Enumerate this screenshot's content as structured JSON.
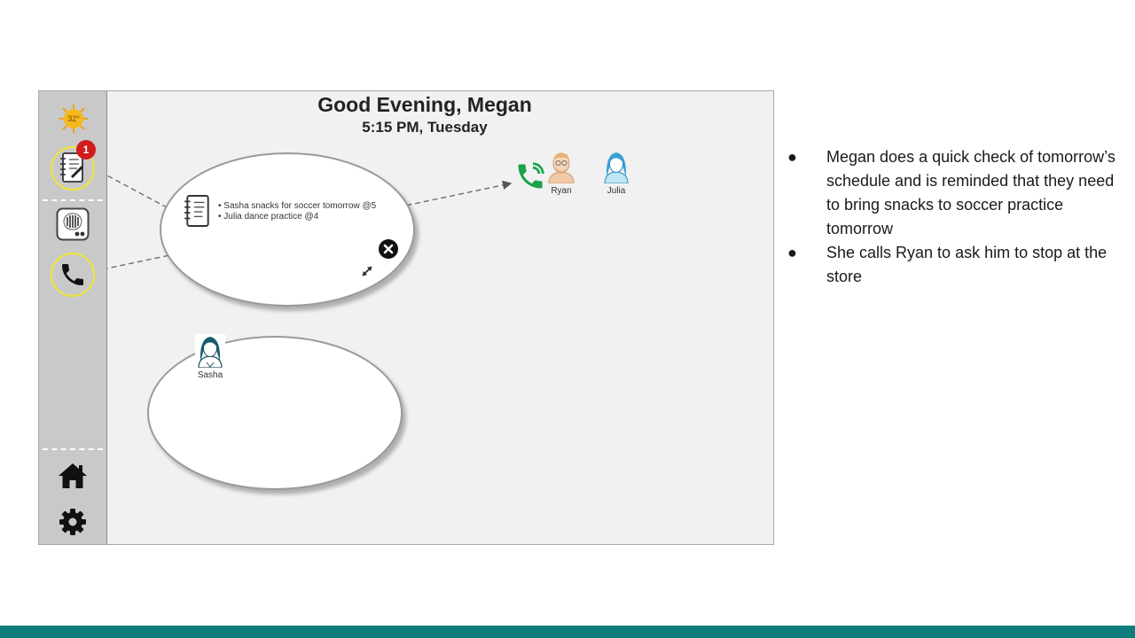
{
  "app": {
    "greeting": "Good Evening, Megan",
    "time_line": "5:15 PM, Tuesday"
  },
  "sidebar": {
    "weather": {
      "temperature": "32°",
      "icon": "sun-icon"
    },
    "notes_badge": "1",
    "items": [
      {
        "id": "notes",
        "icon": "notebook-icon"
      },
      {
        "id": "intercom",
        "icon": "intercom-icon"
      },
      {
        "id": "phone",
        "icon": "phone-icon"
      },
      {
        "id": "home",
        "icon": "home-icon"
      },
      {
        "id": "settings",
        "icon": "gear-icon"
      }
    ]
  },
  "notes_bubble": {
    "items": [
      "• Sasha snacks for soccer tomorrow @5",
      "• Julia dance practice @4"
    ]
  },
  "call": {
    "icon": "phone-call-icon",
    "contacts": [
      {
        "name": "Ryan",
        "icon": "man-avatar-icon"
      },
      {
        "name": "Julia",
        "icon": "woman-avatar-icon"
      }
    ]
  },
  "second_bubble": {
    "person": {
      "name": "Sasha",
      "icon": "woman-avatar-icon"
    }
  },
  "notes_panel": {
    "bullets": [
      "Megan does a quick check of tomorrow’s schedule and is reminded that they need to bring snacks to soccer practice tomorrow",
      "She calls Ryan to ask him to stop at the store"
    ]
  },
  "colors": {
    "accent_bar": "#0d7d7b",
    "highlight_ring": "#efe62f",
    "badge": "#d21b1b",
    "call_green": "#1aa34a"
  }
}
